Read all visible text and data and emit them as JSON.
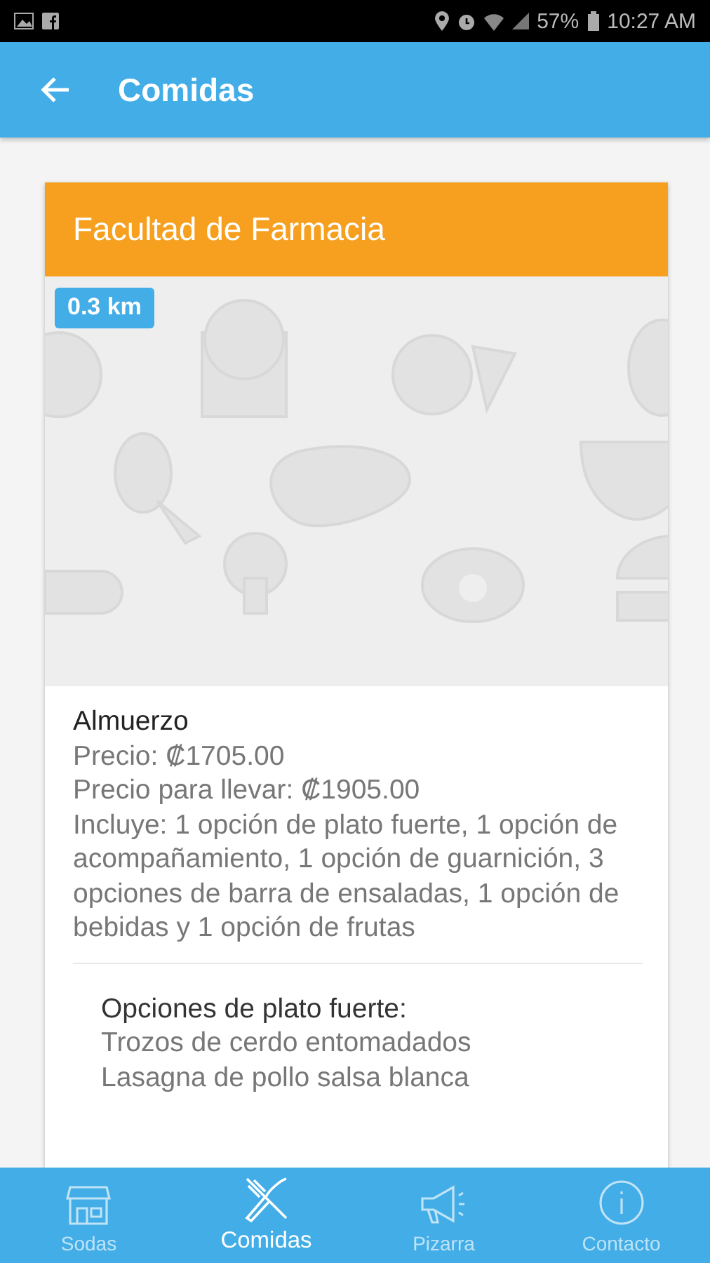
{
  "status_bar": {
    "battery": "57%",
    "time": "10:27 AM"
  },
  "app_bar": {
    "title": "Comidas"
  },
  "card": {
    "title": "Facultad de Farmacia",
    "distance": "0.3 km",
    "image": {
      "kind": "picture"
    },
    "meal": "Almuerzo",
    "details": [
      "Precio: ₡1705.00",
      "Precio para llevar: ₡1905.00",
      "Incluye: 1 opción de plato fuerte, 1 opción de acompañamiento, 1 opción de guarnición, 3 opciones de barra de ensaladas, 1 opción de bebidas y 1 opción de frutas"
    ],
    "options_heading": "Opciones de plato fuerte:",
    "options": [
      "Trozos de cerdo entomadados",
      "Lasagna de pollo salsa blanca"
    ]
  },
  "bottom_nav": [
    {
      "label": "Sodas",
      "kind": "store",
      "selected": false
    },
    {
      "label": "Comidas",
      "kind": "utensils",
      "selected": true
    },
    {
      "label": "Pizarra",
      "kind": "megaphone",
      "selected": false
    },
    {
      "label": "Contacto",
      "kind": "info",
      "selected": false
    }
  ]
}
